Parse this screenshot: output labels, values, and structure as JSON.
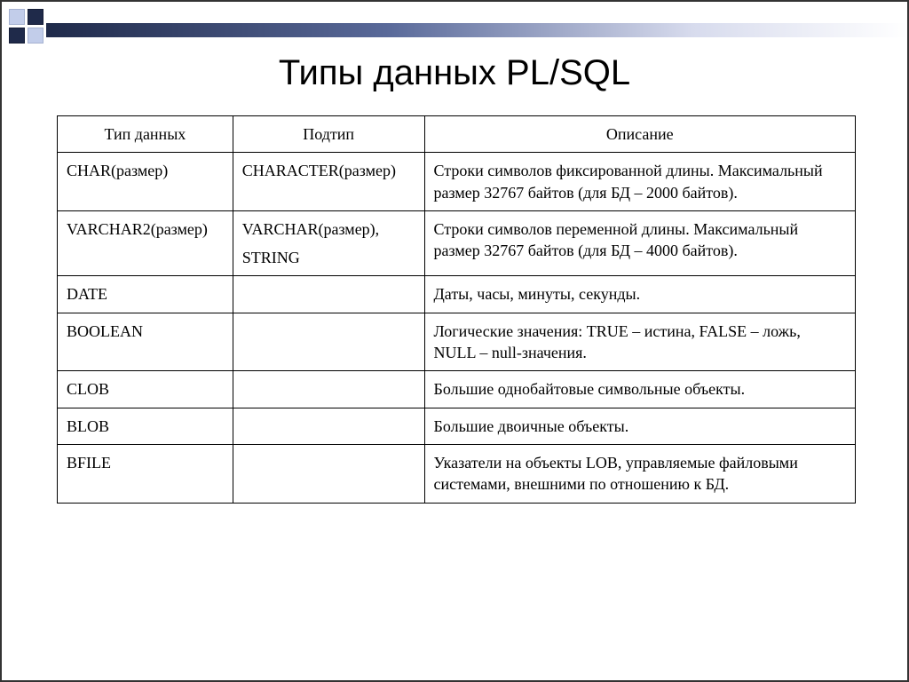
{
  "title": "Типы данных PL/SQL",
  "headers": {
    "c1": "Тип данных",
    "c2": "Подтип",
    "c3": "Описание"
  },
  "rows": [
    {
      "type": "CHAR(размер)",
      "subtype": [
        "CHARACTER(размер)"
      ],
      "desc": "Строки символов фиксированной длины. Максимальный размер 32767 байтов (для БД – 2000 байтов)."
    },
    {
      "type": "VARCHAR2(размер)",
      "subtype": [
        "VARCHAR(размер),",
        "STRING"
      ],
      "desc": "Строки символов переменной длины. Максимальный размер 32767 байтов (для БД – 4000 байтов)."
    },
    {
      "type": "DATE",
      "subtype": [
        ""
      ],
      "desc": "Даты, часы, минуты, секунды."
    },
    {
      "type": "BOOLEAN",
      "subtype": [
        ""
      ],
      "desc": "Логические значения: TRUE – истина, FALSE – ложь, NULL – null-значения."
    },
    {
      "type": "CLOB",
      "subtype": [
        ""
      ],
      "desc": "Большие однобайтовые символьные объекты."
    },
    {
      "type": "BLOB",
      "subtype": [
        ""
      ],
      "desc": "Большие двоичные объекты."
    },
    {
      "type": "BFILE",
      "subtype": [
        ""
      ],
      "desc": "Указатели на объекты LOB, управляемые файловыми системами, внешними по отношению к БД."
    }
  ]
}
